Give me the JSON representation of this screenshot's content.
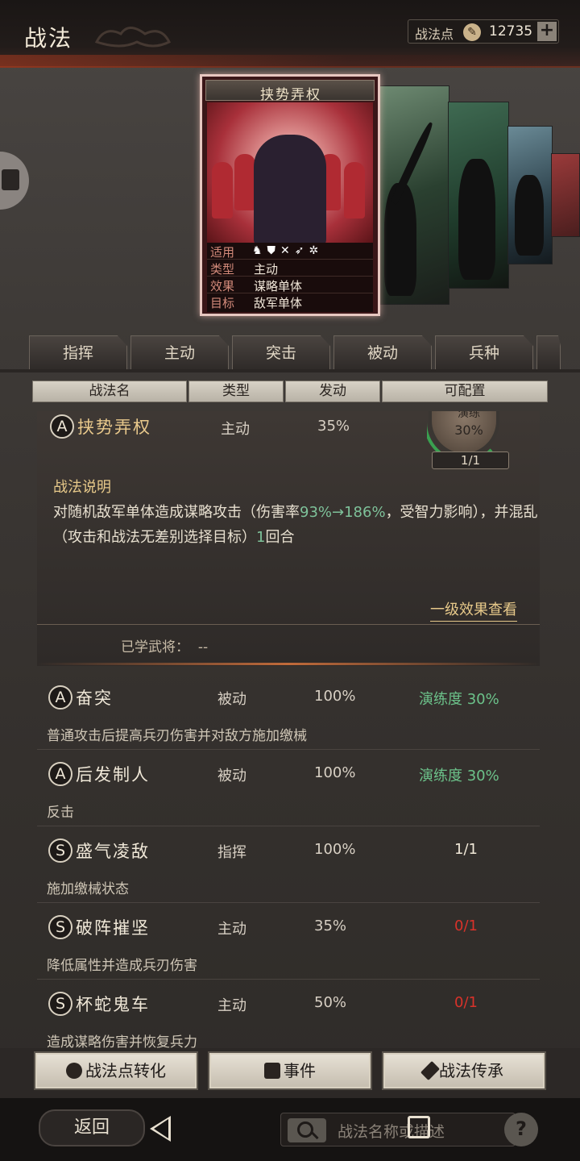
{
  "header": {
    "title": "战法",
    "points_label": "战法点",
    "points_value": "12735",
    "plus_label": "+"
  },
  "card": {
    "name": "挟势弄权",
    "rows": [
      {
        "key": "适用",
        "value": ""
      },
      {
        "key": "类型",
        "value": "主动"
      },
      {
        "key": "效果",
        "value": "谋略单体"
      },
      {
        "key": "目标",
        "value": "敌军单体"
      }
    ]
  },
  "tabs": [
    "指挥",
    "主动",
    "突击",
    "被动",
    "兵种"
  ],
  "columns": [
    "战法名",
    "类型",
    "发动",
    "可配置"
  ],
  "expanded": {
    "grade": "A",
    "name": "挟势弄权",
    "type": "主动",
    "rate": "35%",
    "ring_label": "演练",
    "ring_pct": "30%",
    "ring_count": "1/1",
    "desc_title": "战法说明",
    "desc_part1": "对随机敌军单体造成谋略攻击（伤害率",
    "desc_hl": "93%→186%",
    "desc_part2": "，受智力影响），并混乱（攻击和战法无差别选择目标）",
    "desc_hl2": "1",
    "desc_part3": "回合",
    "effect_link": "一级效果查看",
    "learned_label": "已学武将：",
    "learned_value": "--"
  },
  "rows": [
    {
      "grade": "A",
      "name": "奋突",
      "type": "被动",
      "rate": "100%",
      "cfg": "演练度 30%",
      "cfg_color": "#6cc28a",
      "desc": "普通攻击后提高兵刃伤害并对敌方施加缴械"
    },
    {
      "grade": "A",
      "name": "后发制人",
      "type": "被动",
      "rate": "100%",
      "cfg": "演练度 30%",
      "cfg_color": "#6cc28a",
      "desc": "反击"
    },
    {
      "grade": "S",
      "name": "盛气凌敌",
      "type": "指挥",
      "rate": "100%",
      "cfg": "1/1",
      "cfg_color": "#f0e8d8",
      "desc": "施加缴械状态"
    },
    {
      "grade": "S",
      "name": "破阵摧坚",
      "type": "主动",
      "rate": "35%",
      "cfg": "0/1",
      "cfg_color": "#d8322a",
      "desc": "降低属性并造成兵刃伤害"
    },
    {
      "grade": "S",
      "name": "杯蛇鬼车",
      "type": "主动",
      "rate": "50%",
      "cfg": "0/1",
      "cfg_color": "#d8322a",
      "desc": "造成谋略伤害并恢复兵力"
    }
  ],
  "buttons": {
    "convert": "战法点转化",
    "event": "事件",
    "inherit": "战法传承"
  },
  "nav": {
    "back": "返回",
    "search_placeholder": "战法名称或描述"
  }
}
